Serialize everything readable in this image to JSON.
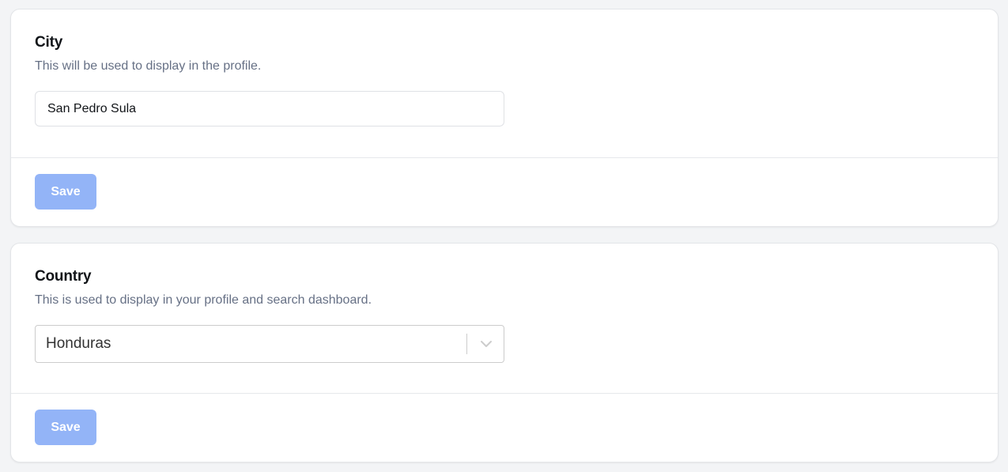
{
  "city": {
    "title": "City",
    "description": "This will be used to display in the profile.",
    "input_value": "San Pedro Sula",
    "save_label": "Save"
  },
  "country": {
    "title": "Country",
    "description": "This is used to display in your profile and search dashboard.",
    "selected_value": "Honduras",
    "save_label": "Save",
    "dropdown_icon": "chevron-down-icon"
  },
  "colors": {
    "background": "#f3f4f6",
    "card": "#ffffff",
    "save_button_disabled": "#93b4f7",
    "description_text": "#667085",
    "title_text": "#111418"
  }
}
